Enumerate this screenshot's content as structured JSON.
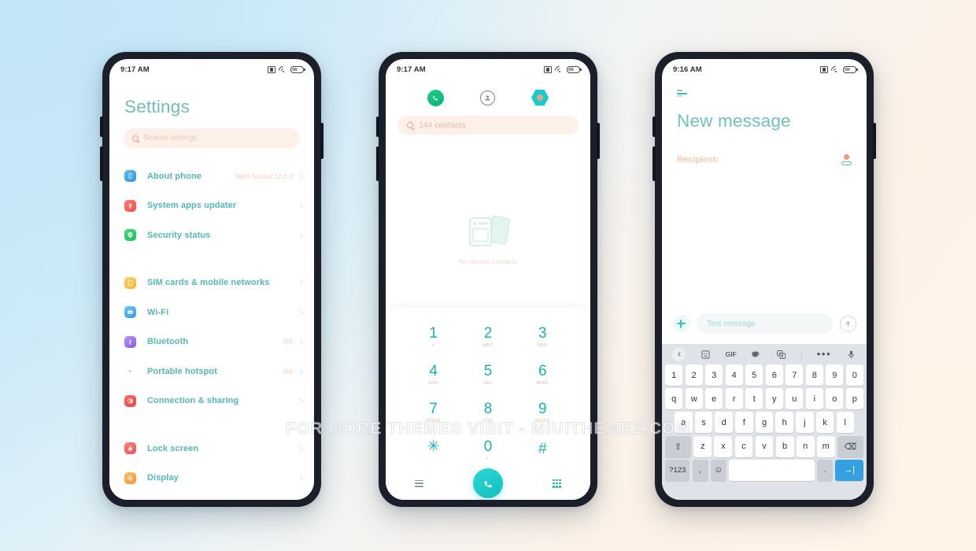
{
  "watermark": "FOR MORE THEMES VISIT - MIUITHEMEZ.COM",
  "theme": {
    "accent_teal": "#16b5b0",
    "accent_teal_light": "#6fbfb8",
    "accent_salmon": "#ef9b83",
    "search_bg": "#fdf0e9",
    "keyboard_bg": "#dfe2e6",
    "enter_blue": "#35a0e0"
  },
  "phone1": {
    "status": {
      "time": "9:17 AM",
      "icons": [
        "sim-icon",
        "wifi-icon",
        "battery-icon"
      ]
    },
    "title": "Settings",
    "search": {
      "placeholder": "Search settings",
      "icon": "search-icon"
    },
    "items": [
      {
        "label": "About phone",
        "value": "MIUI Global 12.0.3",
        "icon": "about-phone-icon",
        "color1": "#5bbdf5",
        "color2": "#2a97e8"
      },
      {
        "label": "System apps updater",
        "value": "",
        "icon": "system-updater-icon",
        "color1": "#fb7a6a",
        "color2": "#f2554a"
      },
      {
        "label": "Security status",
        "value": "",
        "icon": "security-shield-icon",
        "color1": "#4bd97f",
        "color2": "#18bf5c"
      },
      {
        "label": "SIM cards & mobile networks",
        "value": "",
        "icon": "sim-card-icon",
        "color1": "#fcd068",
        "color2": "#f7b733"
      },
      {
        "label": "Wi-Fi",
        "value": "",
        "icon": "wifi-settings-icon",
        "color1": "#63c6f8",
        "color2": "#3a9ae8"
      },
      {
        "label": "Bluetooth",
        "value": "Off",
        "icon": "bluetooth-icon",
        "color1": "#b592f7",
        "color2": "#8a5fe8"
      },
      {
        "label": "Portable hotspot",
        "value": "Off",
        "icon": "hotspot-icon",
        "color1": "#fba martin",
        "color2": "#f08a2c"
      },
      {
        "label": "Connection & sharing",
        "value": "",
        "icon": "connection-sharing-icon",
        "color1": "#fb6b6b",
        "color2": "#ec4545"
      },
      {
        "label": "Lock screen",
        "value": "",
        "icon": "lock-screen-icon",
        "color1": "#fb7f7f",
        "color2": "#ee5555"
      },
      {
        "label": "Display",
        "value": "",
        "icon": "display-icon",
        "color1": "#fcbc6c",
        "color2": "#f59b34"
      }
    ],
    "group_break_after": [
      2,
      7
    ]
  },
  "phone2": {
    "status": {
      "time": "9:17 AM"
    },
    "toolbar": [
      {
        "name": "recent-calls-icon",
        "label": ""
      },
      {
        "name": "contacts-icon",
        "label": ""
      },
      {
        "name": "favorites-hex-icon",
        "label": ""
      }
    ],
    "search": {
      "placeholder": "144 contacts",
      "icon": "search-icon"
    },
    "empty_state": {
      "text": "No recent contacts",
      "icon": "no-contacts-illustration"
    },
    "keypad": [
      {
        "num": "1",
        "sub": "∞"
      },
      {
        "num": "2",
        "sub": "ABC"
      },
      {
        "num": "3",
        "sub": "DEF"
      },
      {
        "num": "4",
        "sub": "GHI"
      },
      {
        "num": "5",
        "sub": "JKL"
      },
      {
        "num": "6",
        "sub": "MNO"
      },
      {
        "num": "7",
        "sub": "PQRS"
      },
      {
        "num": "8",
        "sub": "TUV"
      },
      {
        "num": "9",
        "sub": "WXYZ"
      },
      {
        "num": "✳",
        "sub": ","
      },
      {
        "num": "0",
        "sub": "+"
      },
      {
        "num": "#",
        "sub": ""
      }
    ],
    "bottom": {
      "menu_icon": "menu-icon",
      "call_icon": "call-button",
      "keypad_icon": "keypad-grid-icon"
    }
  },
  "phone3": {
    "status": {
      "time": "9:16 AM"
    },
    "menu_icon": "hamburger-icon",
    "title": "New message",
    "recipient": {
      "label": "Recipient:",
      "icon": "add-contact-icon"
    },
    "compose": {
      "attach_icon": "plus-attach-icon",
      "placeholder": "Text message",
      "send_icon": "send-up-arrow-icon"
    },
    "keyboard": {
      "toolbar": [
        "back-chevron-icon",
        "sticker-icon",
        "GIF",
        "gear-icon",
        "translate-icon",
        "more-dots-icon",
        "mic-icon"
      ],
      "row_numbers": [
        "1",
        "2",
        "3",
        "4",
        "5",
        "6",
        "7",
        "8",
        "9",
        "0"
      ],
      "row_top": [
        "q",
        "w",
        "e",
        "r",
        "t",
        "y",
        "u",
        "i",
        "o",
        "p"
      ],
      "row_mid": [
        "a",
        "s",
        "d",
        "f",
        "g",
        "h",
        "j",
        "k",
        "l"
      ],
      "row_bot_keys": [
        "z",
        "x",
        "c",
        "v",
        "b",
        "n",
        "m"
      ],
      "shift_label": "⇧",
      "delete_label": "⌫",
      "sym_label": "?123",
      "comma_label": ",",
      "emoji_label": "☺",
      "space_label": "",
      "period_label": ".",
      "enter_label": "→|"
    }
  }
}
